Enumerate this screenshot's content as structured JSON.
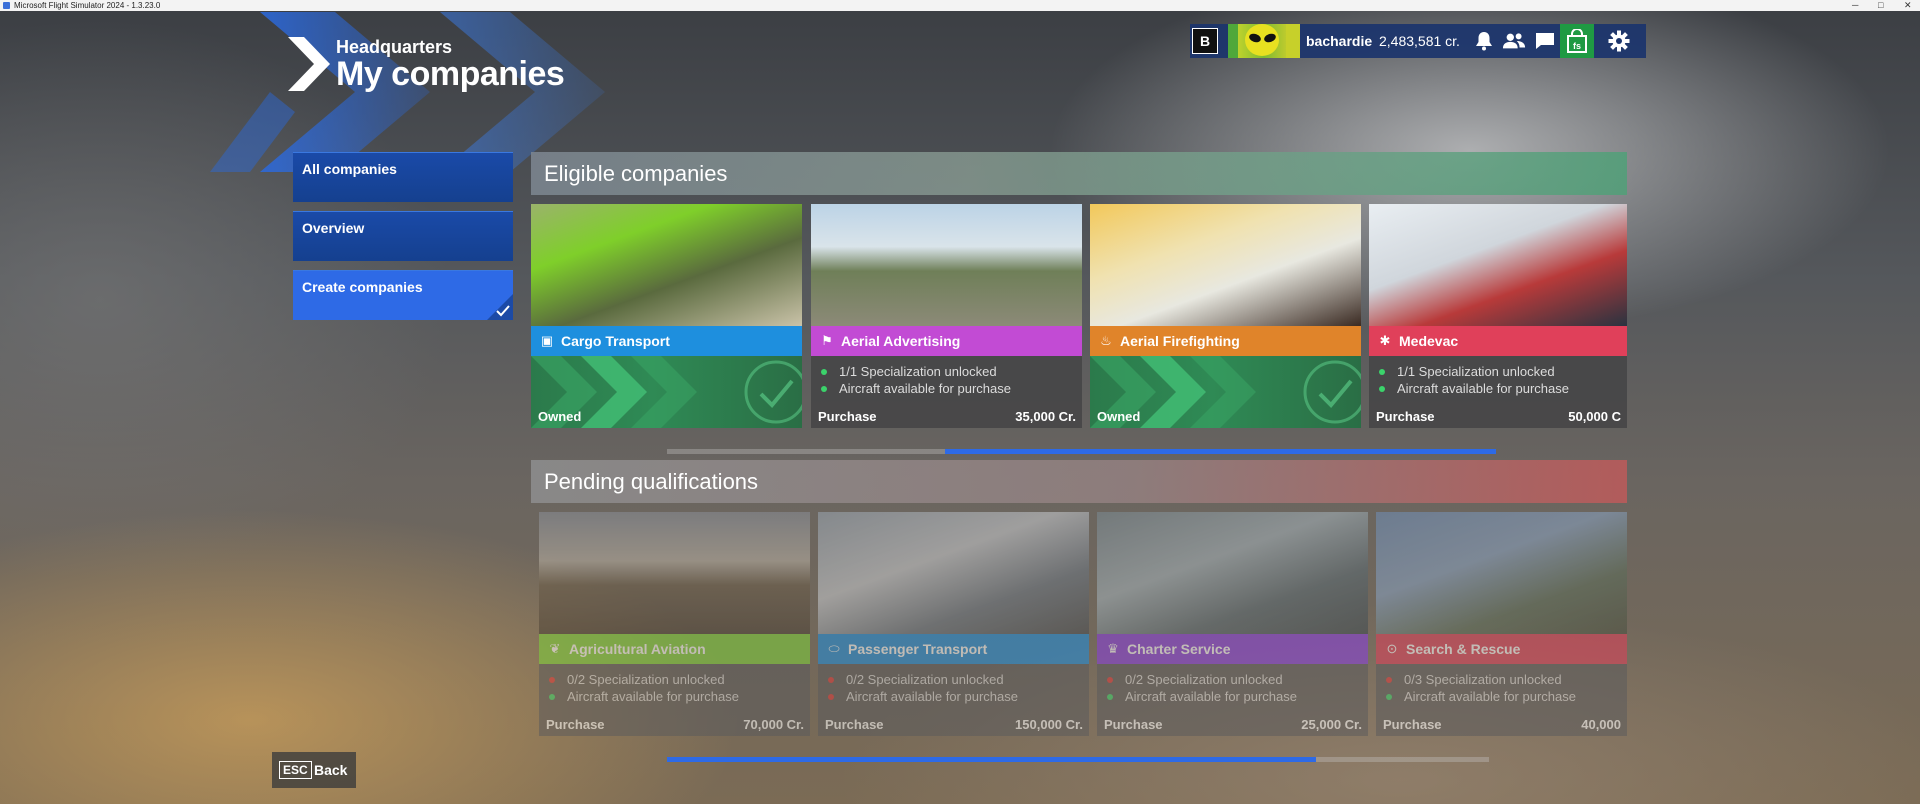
{
  "window": {
    "title": "Microsoft Flight Simulator 2024 - 1.3.23.0"
  },
  "header": {
    "subtitle": "Headquarters",
    "title": "My companies"
  },
  "topbar": {
    "badge": "B",
    "username": "bachardie",
    "credits": "2,483,581 cr."
  },
  "sidebar": {
    "items": [
      {
        "label": "All companies"
      },
      {
        "label": "Overview"
      },
      {
        "label": "Create companies",
        "active": true
      }
    ]
  },
  "eligible": {
    "title": "Eligible companies",
    "scroll_fraction": 0.67,
    "cards": [
      {
        "name": "Cargo Transport",
        "color": "#1e8fde",
        "icon": "box-icon",
        "status": "Owned",
        "price": "",
        "requirements": []
      },
      {
        "name": "Aerial Advertising",
        "color": "#c24bd4",
        "icon": "banner-icon",
        "status": "Purchase",
        "price": "35,000 Cr.",
        "requirements": [
          {
            "text": "1/1 Specialization unlocked",
            "dot": "#3bd36b"
          },
          {
            "text": "Aircraft available for purchase",
            "dot": "#3bd36b"
          }
        ]
      },
      {
        "name": "Aerial Firefighting",
        "color": "#e0842a",
        "icon": "flame-icon",
        "status": "Owned",
        "price": "",
        "requirements": []
      },
      {
        "name": "Medevac",
        "color": "#e0405a",
        "icon": "medical-icon",
        "status": "Purchase",
        "price": "50,000 C",
        "requirements": [
          {
            "text": "1/1 Specialization unlocked",
            "dot": "#3bd36b"
          },
          {
            "text": "Aircraft available for purchase",
            "dot": "#3bd36b"
          }
        ]
      }
    ]
  },
  "pending": {
    "title": "Pending qualifications",
    "scroll_fraction": 0.79,
    "cards": [
      {
        "name": "Agricultural Aviation",
        "color": "#7fd43a",
        "icon": "wheat-icon",
        "status": "Purchase",
        "price": "70,000 Cr.",
        "requirements": [
          {
            "text": "0/2 Specialization unlocked",
            "dot": "#e03a3a"
          },
          {
            "text": "Aircraft available for purchase",
            "dot": "#3bd36b"
          }
        ]
      },
      {
        "name": "Passenger Transport",
        "color": "#1e8fde",
        "icon": "passenger-icon",
        "status": "Purchase",
        "price": "150,000 Cr.",
        "requirements": [
          {
            "text": "0/2 Specialization unlocked",
            "dot": "#e03a3a"
          },
          {
            "text": "Aircraft available for purchase",
            "dot": "#e03a3a"
          }
        ]
      },
      {
        "name": "Charter Service",
        "color": "#8a3ee0",
        "icon": "charter-icon",
        "status": "Purchase",
        "price": "25,000 Cr.",
        "requirements": [
          {
            "text": "0/2 Specialization unlocked",
            "dot": "#e03a3a"
          },
          {
            "text": "Aircraft available for purchase",
            "dot": "#3bd36b"
          }
        ]
      },
      {
        "name": "Search & Rescue",
        "color": "#e0405a",
        "icon": "rescue-icon",
        "status": "Purchase",
        "price": "40,000",
        "requirements": [
          {
            "text": "0/3 Specialization unlocked",
            "dot": "#e03a3a"
          },
          {
            "text": "Aircraft available for purchase",
            "dot": "#3bd36b"
          }
        ]
      }
    ]
  },
  "footer": {
    "key": "ESC",
    "back_label": "Back"
  }
}
